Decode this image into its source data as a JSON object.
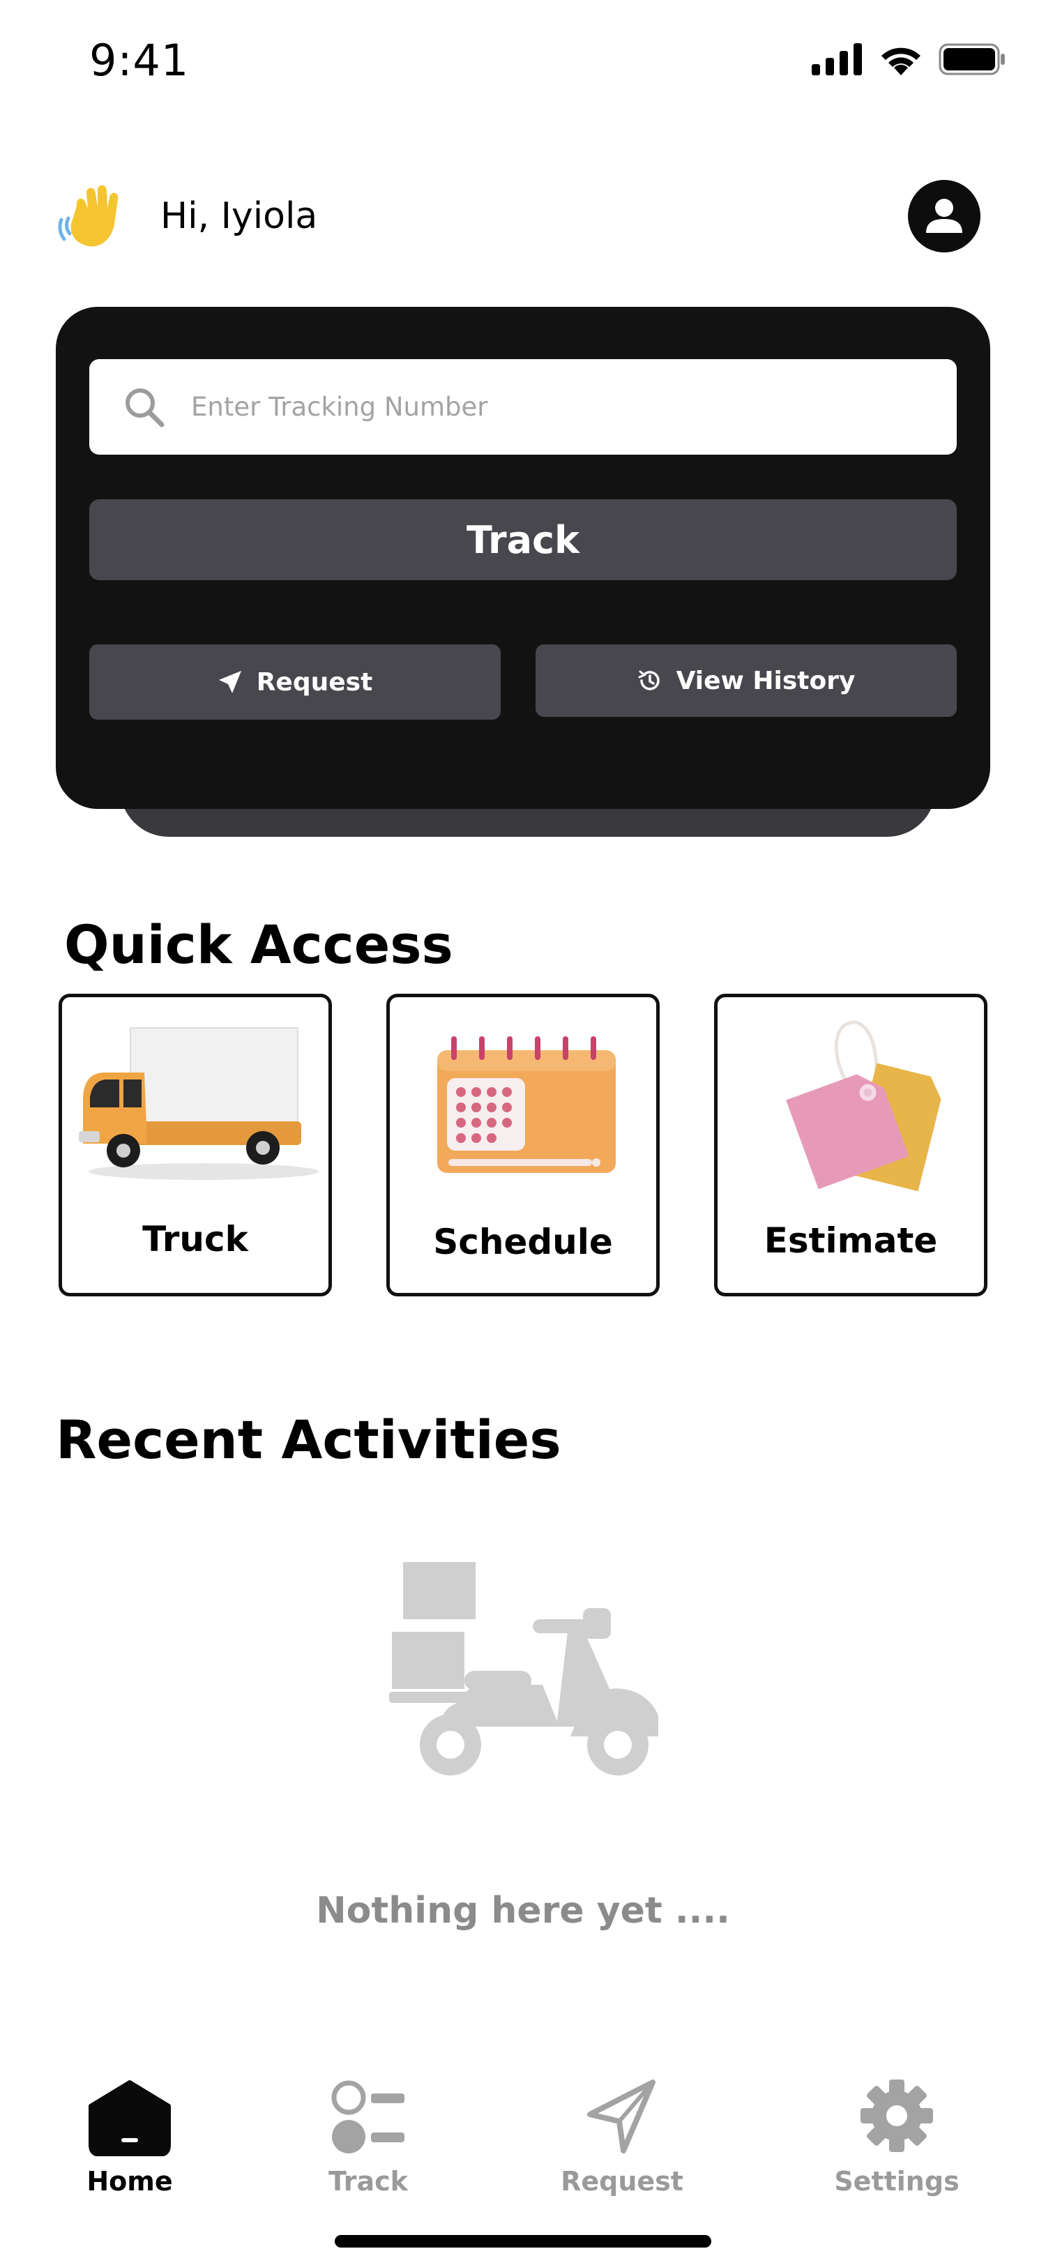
{
  "status_bar": {
    "time": "9:41"
  },
  "header": {
    "greeting": "Hi, Iyiola"
  },
  "tracking_card": {
    "search_placeholder": "Enter Tracking Number",
    "track_label": "Track",
    "request_label": "Request",
    "history_label": "View History"
  },
  "quick_access": {
    "title": "Quick Access",
    "items": [
      {
        "label": "Truck",
        "icon": "truck-illustration"
      },
      {
        "label": "Schedule",
        "icon": "calendar-illustration"
      },
      {
        "label": "Estimate",
        "icon": "price-tag-illustration"
      }
    ]
  },
  "recent_activities": {
    "title": "Recent Activities",
    "empty_text": "Nothing here yet ...."
  },
  "bottom_nav": {
    "items": [
      {
        "label": "Home",
        "icon": "home-icon",
        "active": true
      },
      {
        "label": "Track",
        "icon": "track-icon",
        "active": false
      },
      {
        "label": "Request",
        "icon": "send-icon",
        "active": false
      },
      {
        "label": "Settings",
        "icon": "gear-icon",
        "active": false
      }
    ]
  },
  "colors": {
    "card_bg": "#121212",
    "button_bg": "#48474d",
    "inactive_nav": "#9a9a9a",
    "empty_illustration": "#cfcfcf"
  }
}
